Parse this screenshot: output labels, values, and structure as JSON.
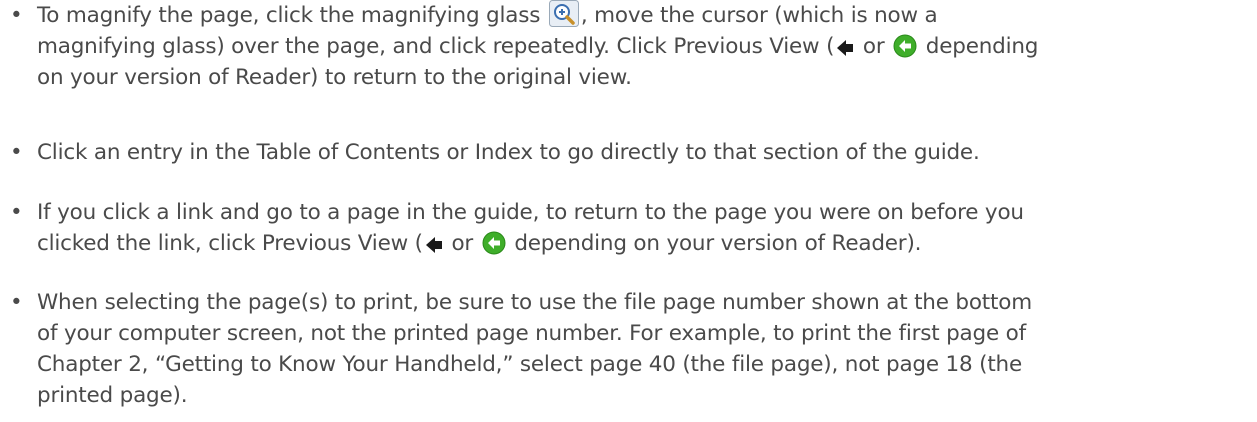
{
  "tips": [
    {
      "lines": [
        {
          "before": "To magnify the page, click the magnifying glass",
          "icon": "magnifier-icon",
          "after": ", move the cursor (which is now a"
        },
        {
          "before": "magnifying glass) over the page, and click repeatedly. Click Previous View (",
          "icon": "back-arrow-icon",
          "mid": " or ",
          "icon2": "green-back-circle-icon",
          "after": " depending"
        },
        {
          "text": "on your version of Reader) to return to the original view."
        }
      ]
    },
    {
      "lines": [
        {
          "text": "Click an entry in the Table of Contents or Index to go directly to that section of the guide."
        }
      ]
    },
    {
      "lines": [
        {
          "text": "If you click a link and go to a page in the guide, to return to the page you were on before you"
        },
        {
          "before": "clicked the link, click Previous View (",
          "icon": "back-arrow-icon",
          "mid": " or ",
          "icon2": "green-back-circle-icon",
          "after": " depending on your version of Reader)."
        }
      ]
    },
    {
      "lines": [
        {
          "text": "When selecting the page(s) to print, be sure to use the file page number shown at the bottom"
        },
        {
          "text": "of your computer screen, not the printed page number. For example, to print the first page of"
        },
        {
          "text": "Chapter 2, “Getting to Know Your Handheld,” select page 40 (the file page), not page 18 (the"
        },
        {
          "text": "printed page)."
        }
      ]
    }
  ],
  "bullet": "•",
  "colors": {
    "text": "#4a4a4a",
    "green_icon": "#3fae2a",
    "arrow_icon": "#1a1a1a"
  }
}
